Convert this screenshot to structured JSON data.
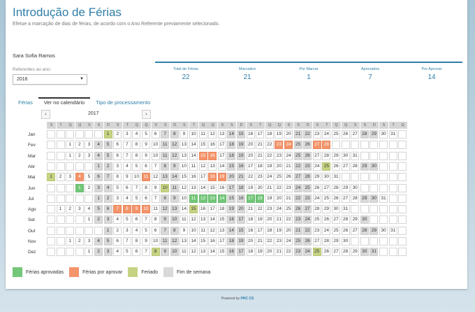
{
  "page": {
    "title": "Introdução de Férias",
    "subtitle": "Efetue a marcação de dias de férias, de acordo com o Ano Referente previamente selecionado."
  },
  "user": {
    "name": "Sara Sofia Ramos"
  },
  "year_filter": {
    "label": "Referentes ao ano:",
    "value": "2016"
  },
  "stats": [
    {
      "label": "Total de Férias",
      "value": "22"
    },
    {
      "label": "Marcados",
      "value": "21"
    },
    {
      "label": "Por Marcar",
      "value": "1"
    },
    {
      "label": "Aprovados",
      "value": "7"
    },
    {
      "label": "Por Aprovar",
      "value": "14"
    }
  ],
  "tabs": [
    {
      "label": "Férias",
      "active": false
    },
    {
      "label": "Ver no calendário",
      "active": true
    },
    {
      "label": "Tipo de processamento",
      "active": false
    }
  ],
  "calendar": {
    "year": "2017",
    "prev_label": "‹",
    "next_label": "›",
    "weekday_headers": [
      "S",
      "T",
      "Q",
      "Q",
      "S",
      "S",
      "D",
      "S",
      "T",
      "Q",
      "Q",
      "S",
      "S",
      "D",
      "S",
      "T",
      "Q",
      "Q",
      "S",
      "S",
      "D",
      "S",
      "T",
      "Q",
      "Q",
      "S",
      "S",
      "D",
      "S",
      "T",
      "Q",
      "Q",
      "S",
      "S",
      "D",
      "S",
      "T",
      "Q"
    ],
    "months": [
      {
        "label": "Jan",
        "start": 6,
        "days": 31
      },
      {
        "label": "Fev",
        "start": 2,
        "days": 28
      },
      {
        "label": "Mar",
        "start": 2,
        "days": 31
      },
      {
        "label": "Abr",
        "start": 5,
        "days": 30
      },
      {
        "label": "Mai",
        "start": 0,
        "days": 31
      },
      {
        "label": "Jun",
        "start": 3,
        "days": 30
      },
      {
        "label": "Jul",
        "start": 5,
        "days": 31
      },
      {
        "label": "Ago",
        "start": 1,
        "days": 31
      },
      {
        "label": "Set",
        "start": 4,
        "days": 30
      },
      {
        "label": "Out",
        "start": 6,
        "days": 31
      },
      {
        "label": "Nov",
        "start": 2,
        "days": 30
      },
      {
        "label": "Dez",
        "start": 4,
        "days": 31
      }
    ],
    "holidays": {
      "Jan": [
        1
      ],
      "Abr": [
        25
      ],
      "Mai": [
        1
      ],
      "Jun": [
        10
      ],
      "Ago": [
        15
      ],
      "Dez": [
        8,
        25
      ]
    },
    "approved": {
      "Jun": [
        1
      ],
      "Jul": [
        11,
        12,
        13,
        14,
        17,
        18
      ]
    },
    "pending": {
      "Fev": [
        23,
        24,
        27,
        28
      ],
      "Mar": [
        15,
        16
      ],
      "Mai": [
        4,
        11,
        18,
        19
      ],
      "Ago": [
        7,
        8,
        9,
        10
      ]
    }
  },
  "legend": [
    {
      "label": "Férias aprovadas",
      "color": "#73c779"
    },
    {
      "label": "Férias por aprovar",
      "color": "#f4946a"
    },
    {
      "label": "Feriado",
      "color": "#c6d383"
    },
    {
      "label": "Fim de semana",
      "color": "#d9d9d9"
    }
  ],
  "footer": {
    "prefix": "Powered by",
    "brand": "PHC CS"
  }
}
